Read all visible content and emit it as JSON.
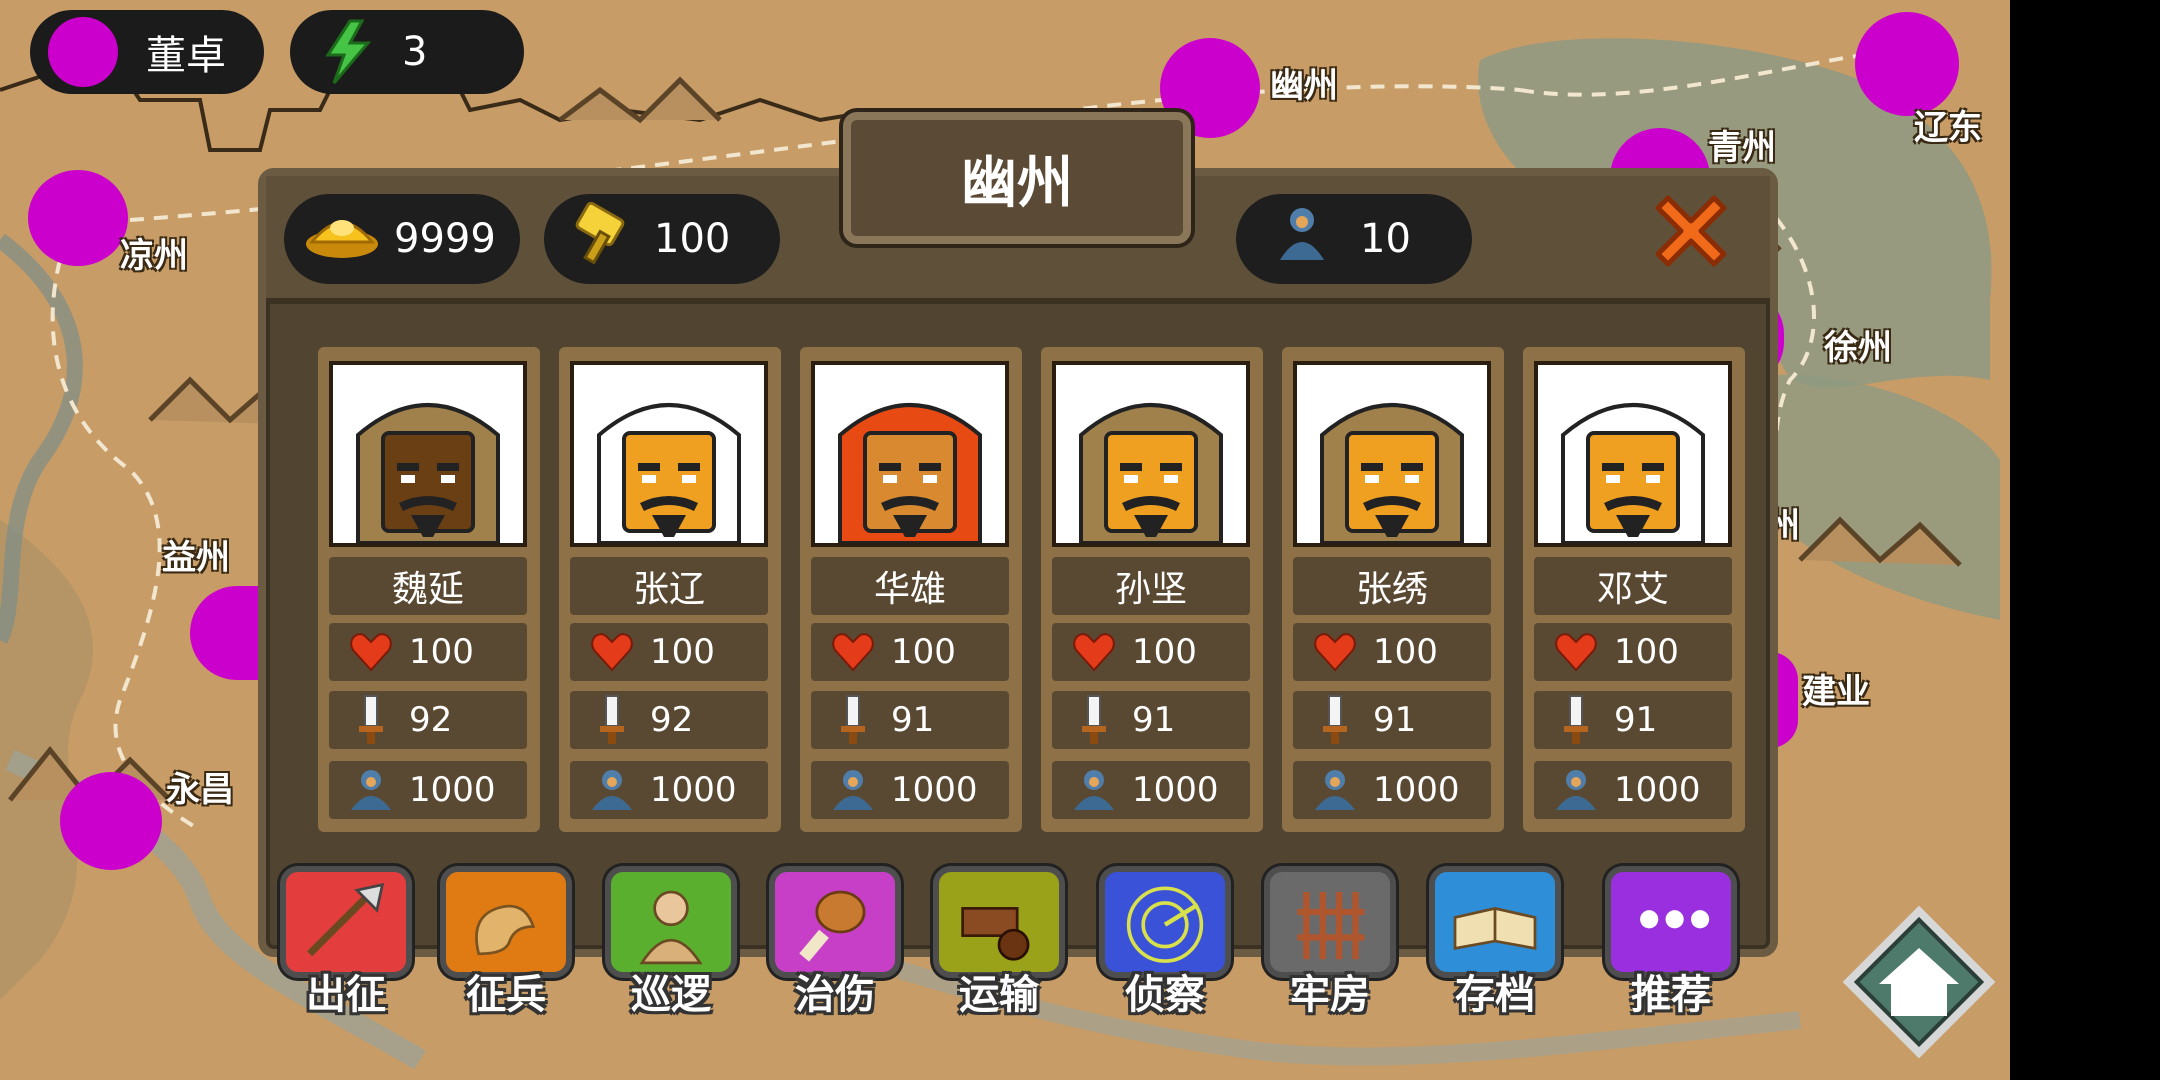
{
  "player": {
    "ruler_name": "董卓",
    "ruler_color": "#cc00cc",
    "energy_icon": "lightning-icon",
    "energy": "3"
  },
  "map": {
    "cities": [
      {
        "name": "幽州"
      },
      {
        "name": "辽东"
      },
      {
        "name": "青州"
      },
      {
        "name": "凉州"
      },
      {
        "name": "徐州"
      },
      {
        "name": "益州"
      },
      {
        "name": "州"
      },
      {
        "name": "建业"
      },
      {
        "name": "永昌"
      }
    ],
    "dot_color": "#cc00cc"
  },
  "panel": {
    "title": "幽州",
    "gold_icon": "gold-ingot-icon",
    "gold": "9999",
    "food_icon": "hammer-icon",
    "food": "100",
    "troops_icon": "soldier-icon",
    "troops": "10",
    "close_icon": "close-x-icon"
  },
  "generals": [
    {
      "name": "魏延",
      "hp": "100",
      "attack": "92",
      "soldiers": "1000",
      "skin": "#6b3f14",
      "hood": "#a0804b"
    },
    {
      "name": "张辽",
      "hp": "100",
      "attack": "92",
      "soldiers": "1000",
      "skin": "#f0a020",
      "hood": "#ffffff"
    },
    {
      "name": "华雄",
      "hp": "100",
      "attack": "91",
      "soldiers": "1000",
      "skin": "#d98a30",
      "hood": "#e84a14"
    },
    {
      "name": "孙坚",
      "hp": "100",
      "attack": "91",
      "soldiers": "1000",
      "skin": "#f0a020",
      "hood": "#a0804b"
    },
    {
      "name": "张绣",
      "hp": "100",
      "attack": "91",
      "soldiers": "1000",
      "skin": "#f0a020",
      "hood": "#a0804b"
    },
    {
      "name": "邓艾",
      "hp": "100",
      "attack": "91",
      "soldiers": "1000",
      "skin": "#f0a020",
      "hood": "#ffffff"
    }
  ],
  "stat_icons": {
    "hp": "heart-icon",
    "attack": "sword-icon",
    "soldiers": "soldier-icon"
  },
  "commands": [
    {
      "label": "出征",
      "icon": "spear-icon",
      "color": "#e43d3d"
    },
    {
      "label": "征兵",
      "icon": "muscle-arm-icon",
      "color": "#e07a12"
    },
    {
      "label": "巡逻",
      "icon": "patrol-soldier-icon",
      "color": "#5ab02e"
    },
    {
      "label": "治伤",
      "icon": "meat-leg-icon",
      "color": "#c73fc7"
    },
    {
      "label": "运输",
      "icon": "ox-cart-icon",
      "color": "#9aa21a"
    },
    {
      "label": "侦察",
      "icon": "radar-icon",
      "color": "#3a52d8"
    },
    {
      "label": "牢房",
      "icon": "prison-bars-icon",
      "color": "#6a6a6a"
    },
    {
      "label": "存档",
      "icon": "book-icon",
      "color": "#2e8fd8"
    },
    {
      "label": "推荐",
      "icon": "more-dots-icon",
      "color": "#9a2fe0"
    }
  ],
  "home": {
    "icon": "home-icon"
  }
}
